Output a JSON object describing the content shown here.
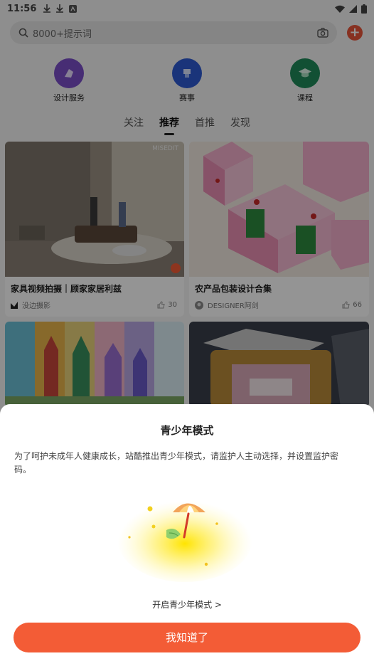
{
  "status_bar": {
    "time": "11:56"
  },
  "search": {
    "placeholder": "8000+提示词"
  },
  "categories": [
    {
      "label": "设计服务",
      "icon": "design-service-icon",
      "color": "#7b4fc9"
    },
    {
      "label": "赛事",
      "icon": "competition-icon",
      "color": "#2d5bd2"
    },
    {
      "label": "课程",
      "icon": "course-icon",
      "color": "#1f8a5b"
    }
  ],
  "tabs": [
    {
      "label": "关注"
    },
    {
      "label": "推荐",
      "active": true
    },
    {
      "label": "首推"
    },
    {
      "label": "发现"
    }
  ],
  "feed": [
    {
      "title": "家具视频拍摄｜顾家家居利兹",
      "author": "没边摄影",
      "likes": "30",
      "watermark": "MISEDIT"
    },
    {
      "title": "农产品包装设计合集",
      "author": "DESIGNER阿剑",
      "likes": "66"
    },
    {
      "title": "",
      "author": "",
      "likes": ""
    },
    {
      "title": "",
      "author": "",
      "likes": ""
    }
  ],
  "dialog": {
    "title": "青少年模式",
    "description": "为了呵护未成年人健康成长，站酷推出青少年模式，请监护人主动选择，并设置监护密码。",
    "open_link": "开启青少年模式 >",
    "confirm": "我知道了"
  },
  "colors": {
    "accent": "#f35c36",
    "plus": "#e8553a"
  }
}
